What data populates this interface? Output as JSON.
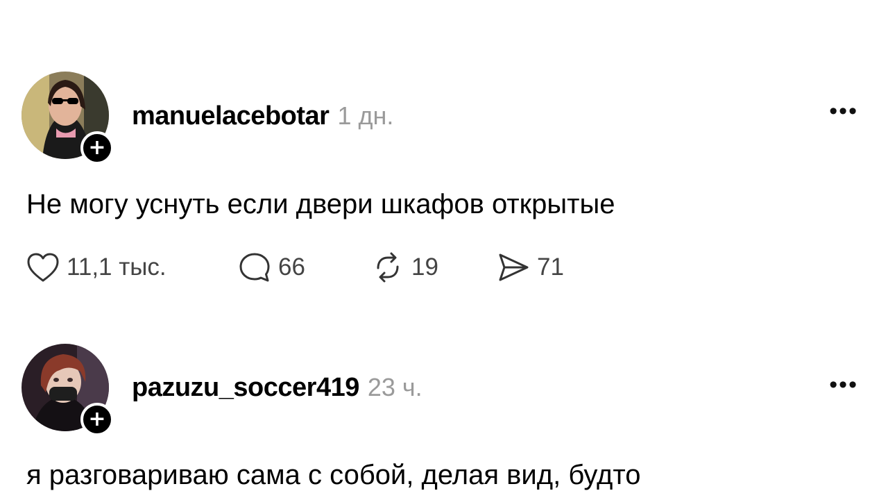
{
  "posts": [
    {
      "username": "manuelacebotar",
      "time": "1 дн.",
      "text": "Не могу уснуть если двери шкафов открытые",
      "more_label": "•••",
      "follow_label": "+",
      "likes": "11,1 тыс.",
      "comments": "66",
      "reposts": "19",
      "shares": "71"
    },
    {
      "username": "pazuzu_soccer419",
      "time": "23 ч.",
      "text": "я разговариваю сама с собой, делая вид, будто",
      "more_label": "•••",
      "follow_label": "+"
    }
  ],
  "icons": {
    "like": "heart-icon",
    "comment": "comment-bubble-icon",
    "repost": "repost-icon",
    "share": "share-send-icon"
  },
  "colors": {
    "text": "#000000",
    "muted": "#9a9a9a",
    "counts": "#444444"
  }
}
